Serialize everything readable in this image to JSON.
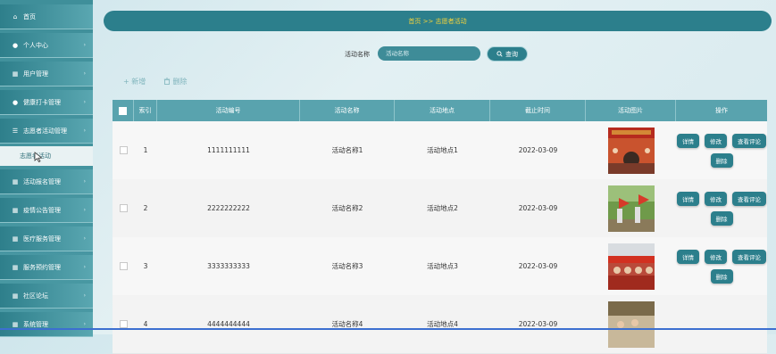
{
  "sidebar": {
    "items": [
      {
        "icon": "home-icon",
        "glyph": "⌂",
        "label": "首页",
        "chev": ""
      },
      {
        "icon": "user-icon",
        "glyph": "●",
        "label": "个人中心",
        "chev": "›"
      },
      {
        "icon": "grid-icon",
        "glyph": "▦",
        "label": "用户管理",
        "chev": "›"
      },
      {
        "icon": "user-icon",
        "glyph": "●",
        "label": "健康打卡管理",
        "chev": "›"
      },
      {
        "icon": "sliders-icon",
        "glyph": "☰",
        "label": "志愿者活动管理",
        "chev": "›"
      },
      {
        "icon": "grid-icon",
        "glyph": "▦",
        "label": "活动报名管理",
        "chev": "›"
      },
      {
        "icon": "grid-icon",
        "glyph": "▦",
        "label": "疫情公告管理",
        "chev": "›"
      },
      {
        "icon": "grid-icon",
        "glyph": "▦",
        "label": "医疗服务管理",
        "chev": "›"
      },
      {
        "icon": "grid-icon",
        "glyph": "▦",
        "label": "服务预约管理",
        "chev": "›"
      },
      {
        "icon": "grid-icon",
        "glyph": "▦",
        "label": "社区论坛",
        "chev": "›"
      },
      {
        "icon": "grid-icon",
        "glyph": "▦",
        "label": "系统管理",
        "chev": "›"
      }
    ],
    "sub_item": "志愿者活动"
  },
  "breadcrumb": {
    "text": "首页 >> 志愿者活动"
  },
  "search": {
    "label": "活动名称",
    "placeholder": "活动名称",
    "button": "查询"
  },
  "actions": {
    "add": "+ 新增",
    "delete": "删除"
  },
  "table": {
    "headers": [
      "",
      "索引",
      "活动编号",
      "活动名称",
      "活动地点",
      "截止时间",
      "活动图片",
      "操作"
    ],
    "rows": [
      {
        "index": "1",
        "code": "1111111111",
        "name": "活动名称1",
        "place": "活动地点1",
        "deadline": "2022-03-09"
      },
      {
        "index": "2",
        "code": "2222222222",
        "name": "活动名称2",
        "place": "活动地点2",
        "deadline": "2022-03-09"
      },
      {
        "index": "3",
        "code": "3333333333",
        "name": "活动名称3",
        "place": "活动地点3",
        "deadline": "2022-03-09"
      },
      {
        "index": "4",
        "code": "4444444444",
        "name": "活动名称4",
        "place": "活动地点4",
        "deadline": "2022-03-09"
      }
    ],
    "ops": {
      "detail": "详情",
      "edit": "修改",
      "comments": "查看评论",
      "remove": "删除"
    }
  },
  "colors": {
    "accent": "#2c7f8c",
    "breadcrumb_text": "#f5d33a",
    "header_bg": "#59a3ae"
  }
}
